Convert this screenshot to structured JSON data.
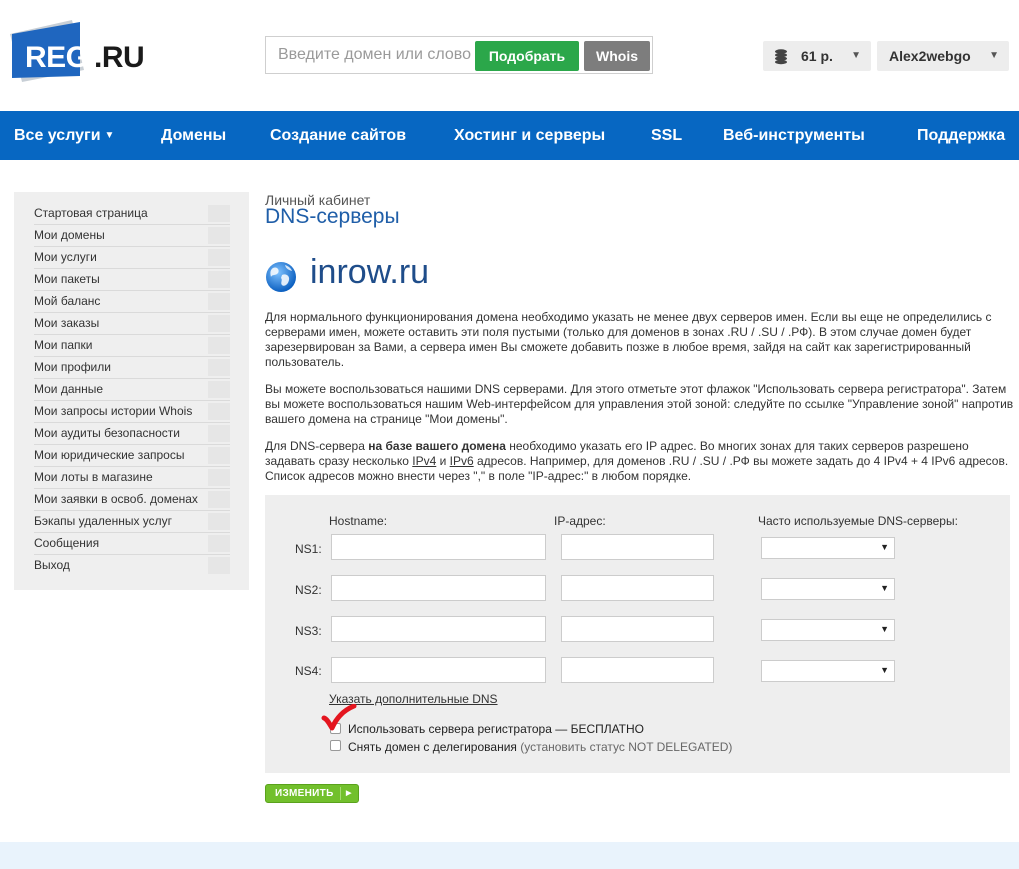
{
  "header": {
    "logo": {
      "main": "REG",
      "suffix": ".RU"
    },
    "search": {
      "placeholder": "Введите домен или слово",
      "pick_button": "Подобрать",
      "whois_button": "Whois"
    },
    "balance": "61 р.",
    "user": "Alex2webgo"
  },
  "nav": {
    "items": [
      {
        "label": "Все услуги",
        "has_caret": true
      },
      {
        "label": "Домены"
      },
      {
        "label": "Создание сайтов"
      },
      {
        "label": "Хостинг и серверы"
      },
      {
        "label": "SSL"
      },
      {
        "label": "Веб-инструменты"
      },
      {
        "label": "Поддержка"
      }
    ]
  },
  "sidebar": {
    "items": [
      "Стартовая страница",
      "Мои домены",
      "Мои услуги",
      "Мои пакеты",
      "Мой баланс",
      "Мои заказы",
      "Мои папки",
      "Мои профили",
      "Мои данные",
      "Мои запросы истории Whois",
      "Мои аудиты безопасности",
      "Мои юридические запросы",
      "Мои лоты в магазине",
      "Мои заявки в освоб. доменах",
      "Бэкапы удаленных услуг",
      "Сообщения",
      "Выход"
    ]
  },
  "content": {
    "breadcrumb": "Личный кабинет",
    "title": "DNS-серверы",
    "domain": "inrow.ru",
    "para1": "Для нормального функционирования домена необходимо указать не менее двух серверов имен. Если вы еще не определились с серверами имен, можете оставить эти поля пустыми (только для доменов в зонах .RU / .SU / .РФ). В этом случае домен будет зарезервирован за Вами, а сервера имен Вы сможете добавить позже в любое время, зайдя на сайт как зарегистрированный пользователь.",
    "para2": "Вы можете воспользоваться нашими DNS серверами. Для этого отметьте этот флажок \"Использовать сервера регистратора\". Затем вы можете воспользоваться нашим Web-интерфейсом для управления этой зоной: следуйте по ссылке \"Управление зоной\" напротив вашего домена на странице \"Мои домены\".",
    "para3": {
      "a": "Для DNS-сервера ",
      "b": "на базе вашего домена",
      "c": " необходимо указать его IP адрес. Во многих зонах для таких серверов разрешено задавать сразу несколько ",
      "ipv4": "IPv4",
      "d": " и ",
      "ipv6": "IPv6",
      "e": " адресов. Например, для доменов .RU / .SU / .РФ вы можете задать до 4 IPv4 + 4 IPv6 адресов. Список адресов можно внести через \",\" в поле \"IP-адрес:\" в любом порядке."
    }
  },
  "form": {
    "headers": {
      "hostname": "Hostname:",
      "ip": "IP-адрес:",
      "frequent": "Часто используемые DNS-серверы:"
    },
    "rows": [
      {
        "label": "NS1:",
        "hostname": "",
        "ip": ""
      },
      {
        "label": "NS2:",
        "hostname": "",
        "ip": ""
      },
      {
        "label": "NS3:",
        "hostname": "",
        "ip": ""
      },
      {
        "label": "NS4:",
        "hostname": "",
        "ip": ""
      }
    ],
    "more_dns_link": "Указать дополнительные DNS",
    "use_registrar": {
      "label": "Использовать сервера регистратора — БЕСПЛАТНО",
      "checked": false
    },
    "undelegate": {
      "label": "Снять домен с делегирования",
      "note": "(установить статус NOT DELEGATED)",
      "checked": false
    },
    "submit": "ИЗМЕНИТЬ"
  },
  "colors": {
    "brand_blue": "#0767c2",
    "green": "#2ba74a",
    "red_mark": "#e4151f"
  }
}
